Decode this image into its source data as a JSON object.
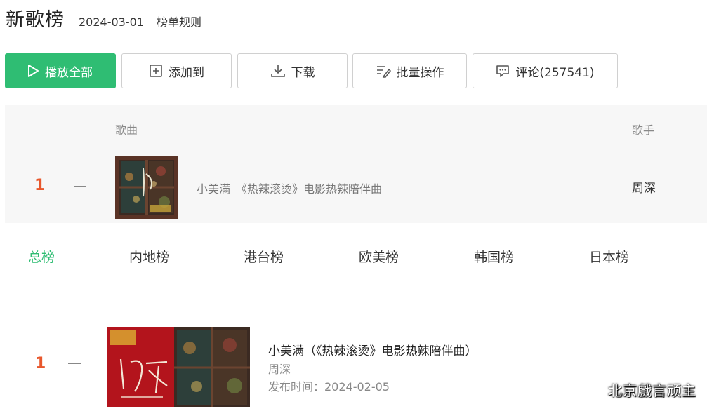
{
  "header": {
    "title": "新歌榜",
    "date": "2024-03-01",
    "rules_link": "榜单规则"
  },
  "toolbar": {
    "play_all": "播放全部",
    "add_to": "添加到",
    "download": "下载",
    "batch": "批量操作",
    "comment": "评论(257541)"
  },
  "list": {
    "col_song": "歌曲",
    "col_artist": "歌手",
    "row": {
      "rank": "1",
      "title": "小美满　《热辣滚烫》电影热辣陪伴曲",
      "artist": "周深"
    }
  },
  "tabs": [
    "总榜",
    "内地榜",
    "港台榜",
    "欧美榜",
    "韩国榜",
    "日本榜"
  ],
  "detail": {
    "rank": "1",
    "title": "小美满（《热辣滚烫》电影热辣陪伴曲）",
    "artist": "周深",
    "release": "发布时间：2024-02-05"
  },
  "watermark": "北京戲言顽主",
  "colors": {
    "accent": "#2fbd73",
    "rank": "#e8572c",
    "panel_bg": "#f7f7f7"
  },
  "icons": {
    "play": "play-icon",
    "add": "plus-square-icon",
    "download": "download-icon",
    "batch": "batch-edit-icon",
    "comment": "comment-icon"
  }
}
